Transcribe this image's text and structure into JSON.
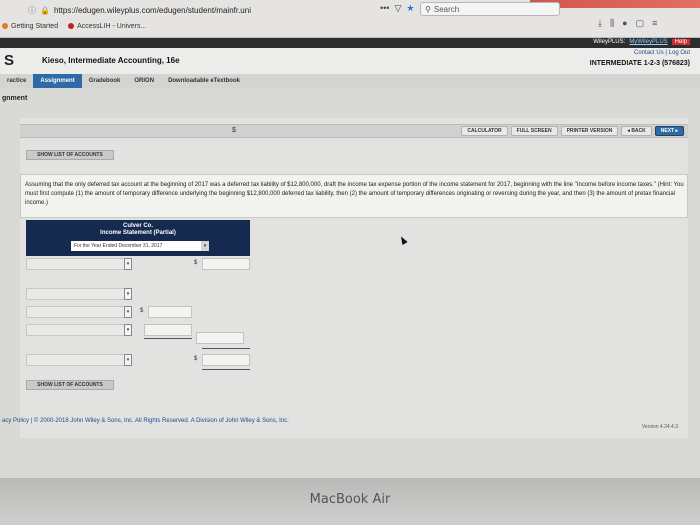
{
  "browser": {
    "url": "https://edugen.wileyplus.com/edugen/student/mainfr.uni",
    "search_placeholder": "Search",
    "bookmarks": [
      "Getting Started",
      "AccessLIH - Univers..."
    ]
  },
  "wiley": {
    "top_links": [
      "WileyPLUS:",
      "MyWileyPLUS",
      "Help",
      "Contact Us",
      "Log Out"
    ],
    "logo": "S",
    "course_title": "Kieso, Intermediate Accounting, 16e",
    "chapter_info": "INTERMEDIATE 1-2-3 (576823)",
    "nav": [
      "ractice",
      "Assignment",
      "Gradebook",
      "ORION",
      "Downloadable eTextbook"
    ],
    "active_nav": "Assignment",
    "section_title": "gnment"
  },
  "toolbar": {
    "dollar": "$",
    "buttons": [
      "CALCULATOR",
      "FULL SCREEN",
      "PRINTER VERSION",
      "◂ BACK",
      "NEXT ▸"
    ]
  },
  "show_list_label": "SHOW LIST OF ACCOUNTS",
  "question": "Assuming that the only deferred tax account at the beginning of 2017 was a deferred tax liability of $12,800,000, draft the income tax expense portion of the income statement for 2017, beginning with the line \"Income before income taxes.\" (Hint: You must first compute (1) the amount of temporary difference underlying the beginning $12,800,000 deferred tax liability, then (2) the amount of temporary differences originating or reversing during the year, and then (3) the amount of pretax financial income.)",
  "statement": {
    "company": "Culver Co.",
    "title": "Income Statement (Partial)",
    "period": "For the Year Ended December 31, 2017"
  },
  "rows": [
    {
      "dollar": "$"
    },
    {
      "dollar": ""
    },
    {
      "dollar": "$"
    },
    {
      "dollar": ""
    },
    {
      "dollar": "$"
    }
  ],
  "footer": {
    "links": "acy Policy  |  © 2000-2018 John Wiley & Sons, Inc. All Rights Reserved. A Division of John Wiley & Sons, Inc.",
    "version": "Version 4.24.4.3"
  },
  "bezel_label": "MacBook Air"
}
